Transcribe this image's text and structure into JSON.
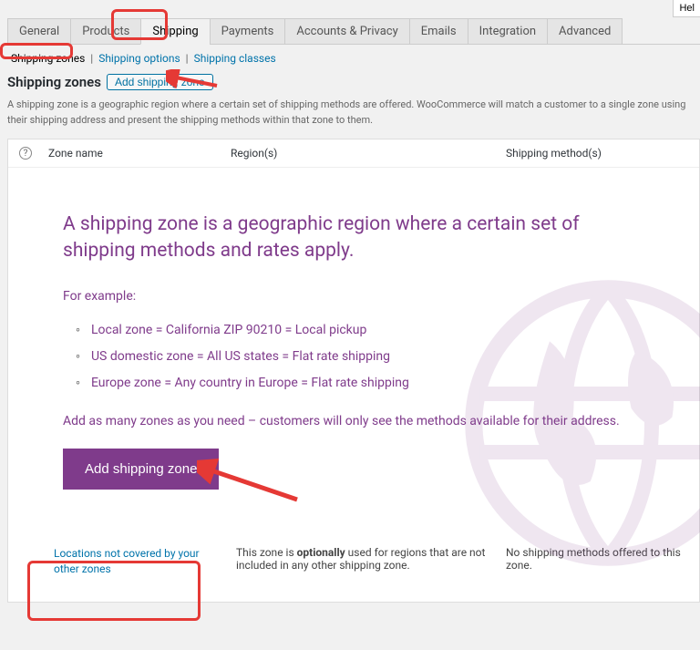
{
  "help_button": "Hel",
  "tabs": {
    "general": "General",
    "products": "Products",
    "shipping": "Shipping",
    "payments": "Payments",
    "accounts": "Accounts & Privacy",
    "emails": "Emails",
    "integration": "Integration",
    "advanced": "Advanced"
  },
  "subtabs": {
    "zones": "Shipping zones",
    "options": "Shipping options",
    "classes": "Shipping classes"
  },
  "heading": "Shipping zones",
  "add_button_small": "Add shipping zone",
  "description": "A shipping zone is a geographic region where a certain set of shipping methods are offered. WooCommerce will match a customer to a single zone using their shipping address and present the shipping methods within that zone to them.",
  "table": {
    "help_icon": "?",
    "col_zone": "Zone name",
    "col_region": "Region(s)",
    "col_method": "Shipping method(s)"
  },
  "empty": {
    "lead": "A shipping zone is a geographic region where a certain set of shipping methods and rates apply.",
    "for_example": "For example:",
    "ex1": "Local zone = California ZIP 90210 = Local pickup",
    "ex2": "US domestic zone = All US states = Flat rate shipping",
    "ex3": "Europe zone = Any country in Europe = Flat rate shipping",
    "outro": "Add as many zones as you need – customers will only see the methods available for their address.",
    "button": "Add shipping zone"
  },
  "footer": {
    "locations_link": "Locations not covered by your other zones",
    "optionally_pre": "This zone is ",
    "optionally_bold": "optionally",
    "optionally_post": " used for regions that are not included in any other shipping zone.",
    "no_methods": "No shipping methods offered to this zone."
  }
}
